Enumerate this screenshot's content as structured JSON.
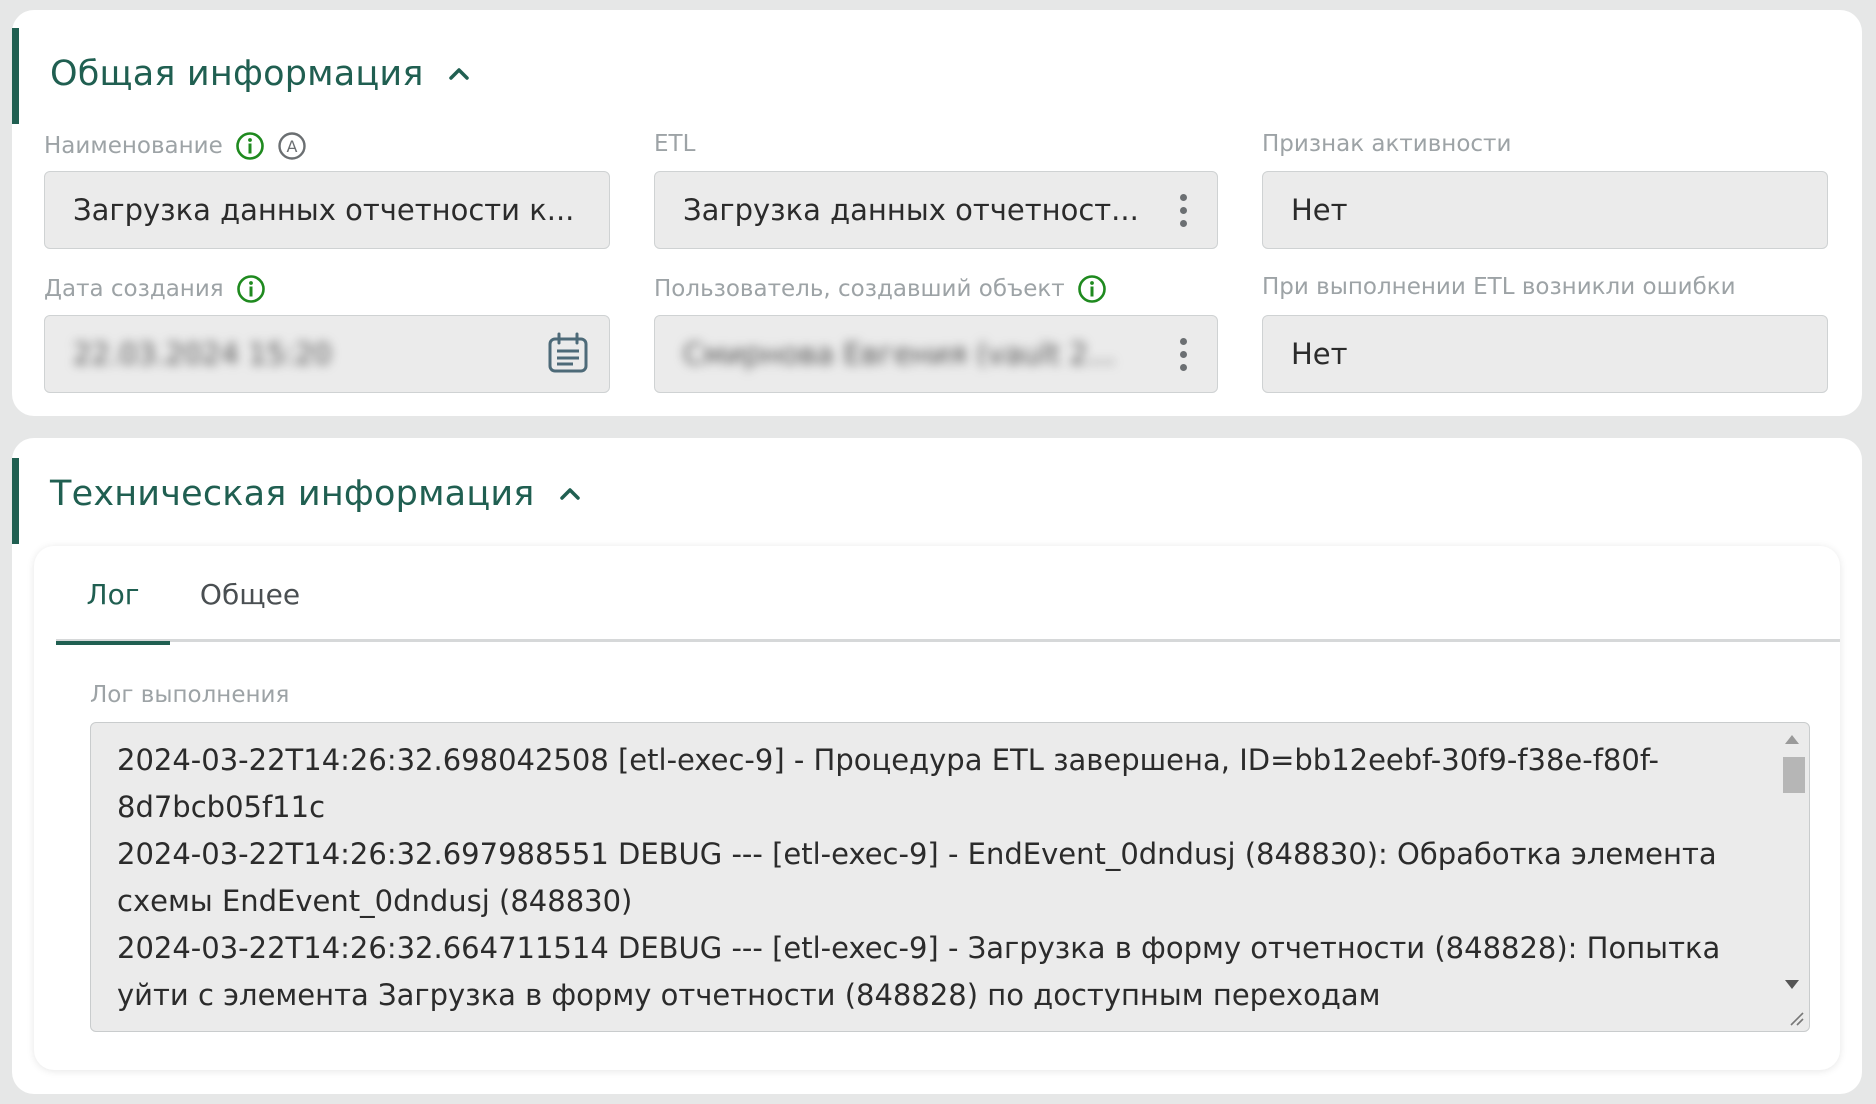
{
  "general": {
    "title": "Общая информация",
    "fields": {
      "name": {
        "label": "Наименование",
        "value": "Загрузка данных отчетности к..."
      },
      "etl": {
        "label": "ETL",
        "value": "Загрузка данных отчетност..."
      },
      "active": {
        "label": "Признак активности",
        "value": "Нет"
      },
      "created": {
        "label": "Дата создания",
        "value": "22.03.2024 15:20"
      },
      "creator": {
        "label": "Пользователь, создавший объект",
        "value": "Смирнова Евгения (vault 2..."
      },
      "errors": {
        "label": "При выполнении ETL возникли ошибки",
        "value": "Нет"
      }
    }
  },
  "tech": {
    "title": "Техническая информация",
    "tabs": [
      {
        "label": "Лог",
        "active": true
      },
      {
        "label": "Общее",
        "active": false
      }
    ],
    "log_label": "Лог выполнения",
    "log_lines": [
      "2024-03-22T14:26:32.698042508 [etl-exec-9] - Процедура ETL завершена, ID=bb12eebf-30f9-f38e-f80f-8d7bcb05f11c",
      "2024-03-22T14:26:32.697988551 DEBUG --- [etl-exec-9] - EndEvent_0dndusj (848830): Обработка элемента схемы EndEvent_0dndusj (848830)",
      "2024-03-22T14:26:32.664711514 DEBUG --- [etl-exec-9] - Загрузка в форму отчетности (848828): Попытка уйти с элемента Загрузка в форму отчетности (848828) по доступным переходам"
    ]
  },
  "colors": {
    "accent": "#205f51",
    "info_icon": "#1f8a1f",
    "field_bg": "#ebebeb",
    "label": "#9da3a6"
  },
  "icons": [
    "chevron-up-icon",
    "info-icon",
    "auto-a-icon",
    "kebab-menu-icon",
    "calendar-icon",
    "scroll-up-icon",
    "scroll-down-icon",
    "resize-handle-icon"
  ]
}
